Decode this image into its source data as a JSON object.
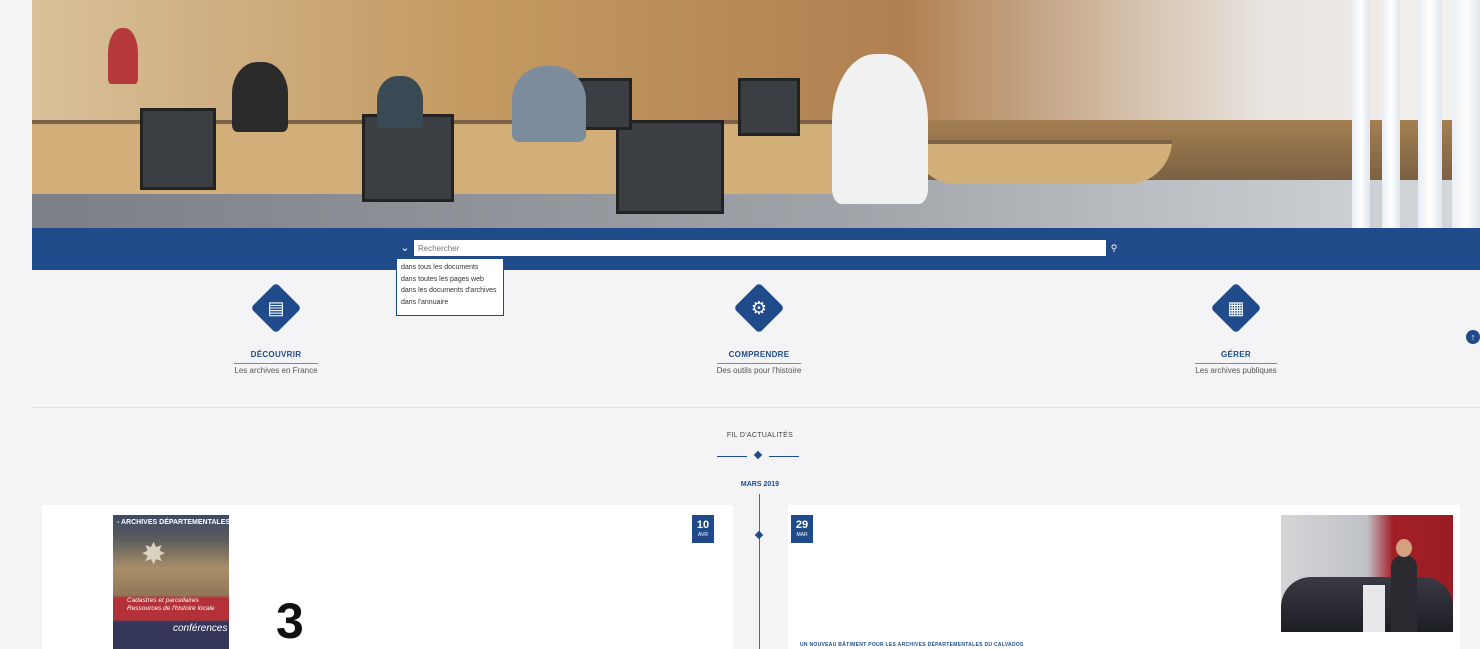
{
  "search": {
    "placeholder": "Rechercher",
    "toggle_icon": "chevron-down-icon",
    "submit_icon": "search-icon",
    "scopes": [
      "dans tous les documents",
      "dans toutes les pages web",
      "dans les documents d'archives",
      "dans l'annuaire"
    ]
  },
  "pillars": [
    {
      "title": "DÉCOUVRIR",
      "subtitle": "Les archives en France",
      "icon": "archive-box-icon"
    },
    {
      "title": "COMPRENDRE",
      "subtitle": "Des outils pour l'histoire",
      "icon": "gears-icon"
    },
    {
      "title": "GÉRER",
      "subtitle": "Les archives publiques",
      "icon": "binders-icon"
    }
  ],
  "feed": {
    "title": "FIL D'ACTUALITÉS",
    "month": "MARS 2019",
    "left_card": {
      "day": "10",
      "month": "AVR",
      "poster_header": "- ARCHIVES DÉPARTEMENTALES",
      "poster_title": "Cadastres et parcellaires Ressources de l'histoire locale",
      "poster_tag": "conférences",
      "number": "3"
    },
    "right_card": {
      "day": "29",
      "month": "MAR",
      "title": "UN NOUVEAU BÂTIMENT POUR LES ARCHIVES DÉPARTEMENTALES DU CALVADOS"
    }
  },
  "colors": {
    "brand": "#1f4b8a",
    "background": "#f4f4f6",
    "card": "#ffffff"
  },
  "scroll_top_icon": "arrow-up-icon"
}
